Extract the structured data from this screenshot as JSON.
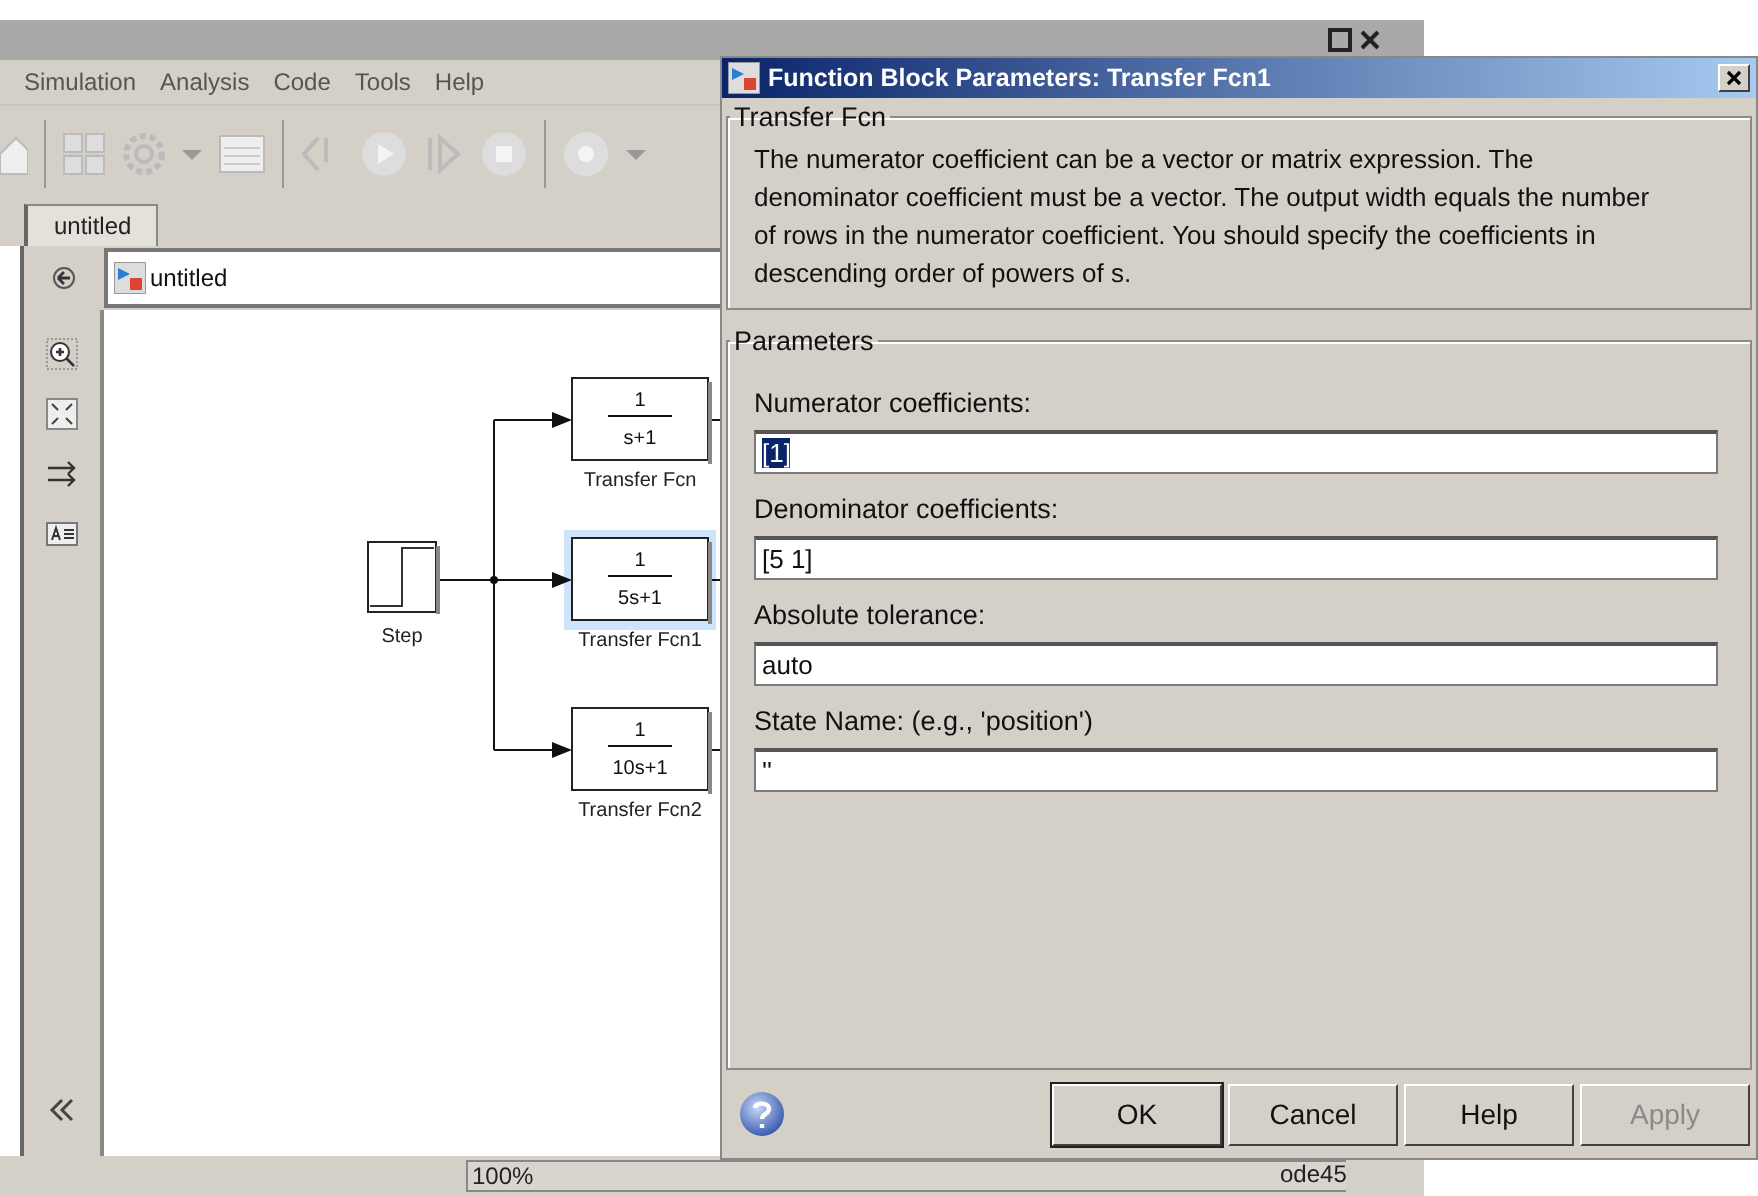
{
  "app": {
    "menu": [
      "Simulation",
      "Analysis",
      "Code",
      "Tools",
      "Help"
    ],
    "tabs": [
      {
        "label": "untitled",
        "selected": true
      }
    ],
    "breadcrumb": "untitled",
    "status_zoom": "100%",
    "status_solver": "ode45"
  },
  "diagram": {
    "blocks": [
      {
        "kind": "step",
        "label": "Step",
        "selected": false
      },
      {
        "kind": "transfer",
        "numerator": "1",
        "denominator": "s+1",
        "label": "Transfer Fcn",
        "selected": false
      },
      {
        "kind": "transfer",
        "numerator": "1",
        "denominator": "5s+1",
        "label": "Transfer Fcn1",
        "selected": true
      },
      {
        "kind": "transfer",
        "numerator": "1",
        "denominator": "10s+1",
        "label": "Transfer Fcn2",
        "selected": false
      }
    ]
  },
  "dialog": {
    "title": "Function Block Parameters: Transfer Fcn1",
    "group": "Transfer Fcn",
    "description": "The numerator coefficient can be a vector or matrix expression. The denominator coefficient must be a vector. The output width equals the number of rows in the numerator coefficient. You should specify the coefficients in descending order of powers of s.",
    "params_title": "Parameters",
    "params": [
      {
        "label": "Numerator coefficients:",
        "value": "[1]",
        "selected": true
      },
      {
        "label": "Denominator coefficients:",
        "value": "[5 1]",
        "selected": false
      },
      {
        "label": "Absolute tolerance:",
        "value": "auto",
        "selected": false
      },
      {
        "label": "State Name: (e.g., 'position')",
        "value": "''",
        "selected": false
      }
    ],
    "buttons": [
      {
        "label": "OK",
        "disabled": false,
        "default": true
      },
      {
        "label": "Cancel",
        "disabled": false,
        "default": false
      },
      {
        "label": "Help",
        "disabled": false,
        "default": false
      },
      {
        "label": "Apply",
        "disabled": true,
        "default": false
      }
    ]
  }
}
